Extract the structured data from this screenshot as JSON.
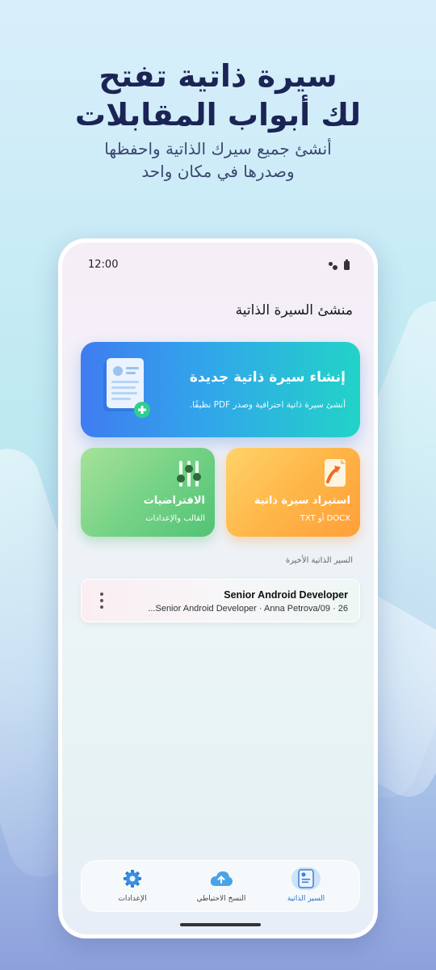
{
  "promo": {
    "headline_line1": "سيرة ذاتية تفتح",
    "headline_line2": "لك أبواب المقابلات",
    "subhead_line1": "أنشئ جميع سيرك الذاتية واحفظها",
    "subhead_line2": "وصدرها في مكان واحد"
  },
  "status_bar": {
    "time": "12:00"
  },
  "app": {
    "title": "منشئ السيرة الذاتية"
  },
  "cards": {
    "new": {
      "title": "إنشاء سيرة ذاتية جديدة",
      "subtitle": "أنشئ سيرة ذاتية احترافية وصدر PDF نظيفًا."
    },
    "import": {
      "title": "استيراد سيرة ذاتية",
      "subtitle": "DOCX أو TXT"
    },
    "defaults": {
      "title": "الافتراضيات",
      "subtitle": "القالب والإعدادات"
    }
  },
  "recent": {
    "label": "السير الذاتية الأخيرة",
    "items": [
      {
        "title": "Senior Android Developer",
        "subtitle": "26 · Senior Android Developer · Anna Petrova/09..."
      }
    ]
  },
  "nav": {
    "resumes": "السير الذاتية",
    "backup": "النسخ الاحتياطي",
    "settings": "الإعدادات"
  },
  "colors": {
    "headline": "#1b2454",
    "new_card_start": "#3f7cf0",
    "new_card_end": "#22d3c8",
    "import_card": "#ffb648",
    "defaults_card": "#72d184",
    "nav_active": "#2a6fbf"
  },
  "icons": {
    "new_card": "document-plus-icon",
    "import_card": "document-import-arrow-icon",
    "defaults_card": "sliders-icon",
    "recent_more": "more-vertical-icon",
    "nav_resumes": "resume-doc-icon",
    "nav_backup": "cloud-upload-icon",
    "nav_settings": "gear-icon"
  }
}
